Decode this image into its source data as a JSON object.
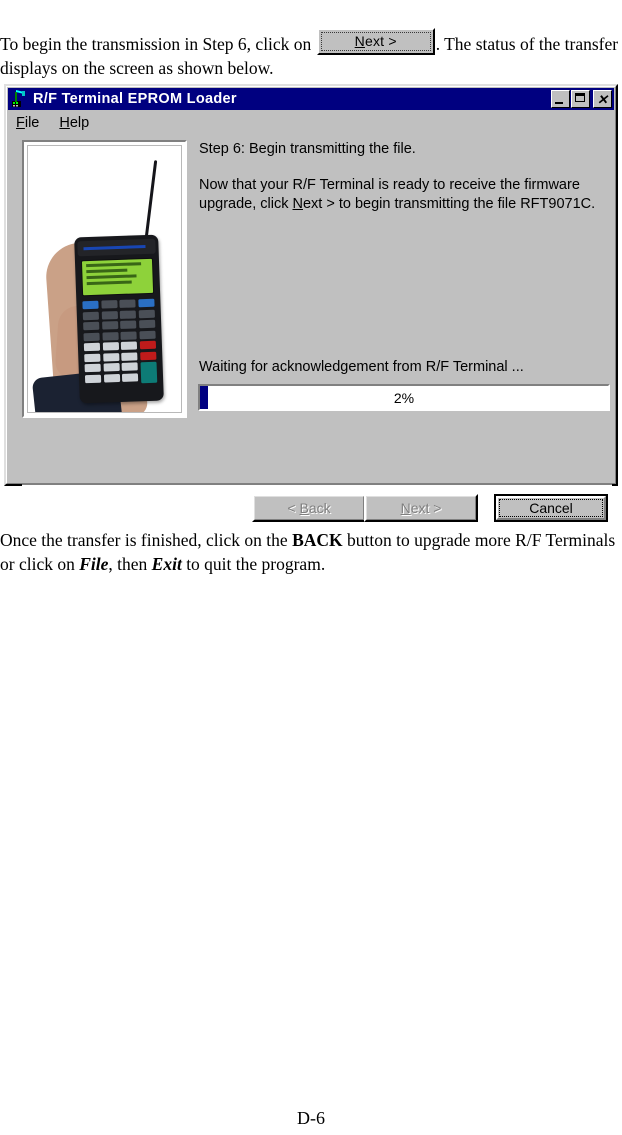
{
  "document": {
    "intro_before": "To begin the transmission in Step 6, click on",
    "inline_button_label": "Next >",
    "inline_button_mnemonic": "N",
    "intro_after": ". The status of the transfer displays on the screen as shown below.",
    "closing_part1": "Once the transfer is finished, click on the ",
    "closing_bold": "BACK",
    "closing_part2": " button to upgrade more R/F Terminals or click on ",
    "closing_italic1": "File",
    "closing_part3": ", then ",
    "closing_italic2": "Exit",
    "closing_part4": " to quit the program.",
    "page_number": "D-6"
  },
  "dialog": {
    "title": "R/F Terminal EPROM Loader",
    "title_icon": "rf-terminal-icon",
    "window_buttons": {
      "minimize": "minimize-button",
      "maximize": "maximize-button",
      "close": "close-button"
    },
    "menu": [
      {
        "label": "File",
        "mnemonic": "F"
      },
      {
        "label": "Help",
        "mnemonic": "H"
      }
    ],
    "image_caption": "photo-of-hand-holding-rf-terminal",
    "step_title": "Step 6: Begin transmitting the file.",
    "body_line1_a": "Now that your R/F Terminal is ready to receive the firmware",
    "body_line2_a": "upgrade, click ",
    "body_line2_mnemonic": "N",
    "body_line2_b": "ext > to begin transmitting the file RFT9071C.",
    "status": "Waiting for acknowledgement from R/F Terminal ...",
    "progress": {
      "percent_label": "2%",
      "percent_value": 2,
      "fill_color": "#000080",
      "track_color": "#ffffff"
    },
    "buttons": {
      "back": {
        "label": "< Back",
        "mnemonic": "B",
        "disabled": true
      },
      "next": {
        "label": "Next >",
        "mnemonic": "N",
        "disabled": true
      },
      "cancel": {
        "label": "Cancel",
        "disabled": false,
        "focused": true
      }
    },
    "colors": {
      "titlebar": "#000080",
      "face": "#c0c0c0",
      "highlight": "#ffffff",
      "shadow": "#808080"
    }
  }
}
